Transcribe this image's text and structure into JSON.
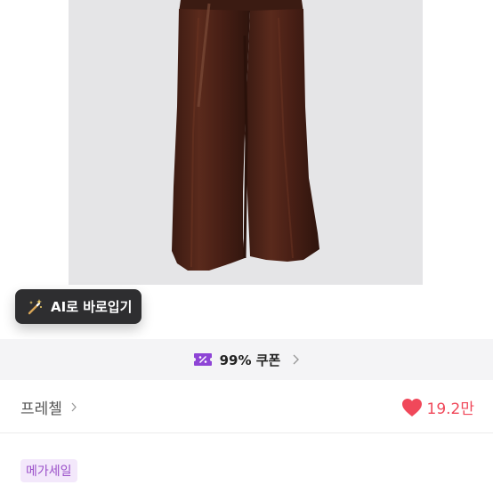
{
  "product": {
    "image_icon": "brown-wide-leg-pants-photo",
    "ai_button_label": "AI로 바로입기",
    "ai_icon": "magic-wand-sparkle-icon"
  },
  "coupon": {
    "label": "99% 쿠폰",
    "icon": "coupon-ticket-icon",
    "accent": "#8e44d6"
  },
  "seller": {
    "name": "프레첼",
    "icon": "chevron-right-icon"
  },
  "likes": {
    "count": "19.2만",
    "icon": "heart-icon",
    "color": "#f0485a"
  },
  "tag": {
    "label": "메가세일"
  }
}
